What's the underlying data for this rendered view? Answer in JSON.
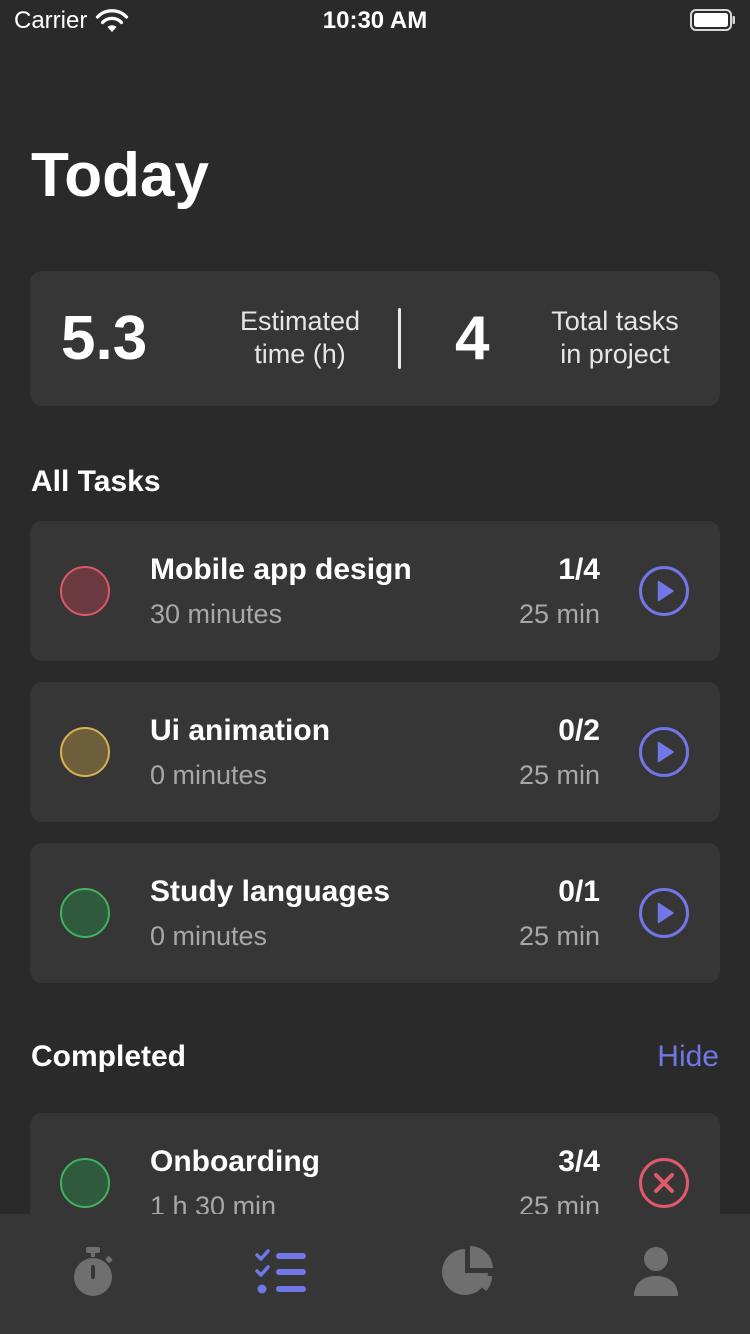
{
  "status_bar": {
    "carrier": "Carrier",
    "time": "10:30 AM",
    "wifi_icon": "wifi-icon",
    "battery_icon": "battery-icon"
  },
  "title": "Today",
  "stats": {
    "estimated_value": "5.3",
    "estimated_label_line1": "Estimated",
    "estimated_label_line2": "time (h)",
    "tasks_value": "4",
    "tasks_label_line1": "Total tasks",
    "tasks_label_line2": "in project"
  },
  "all_tasks": {
    "title": "All Tasks",
    "items": [
      {
        "name": "Mobile app design",
        "duration": "30 minutes",
        "progress": "1/4",
        "pomodoro": "25 min",
        "color": "#d85a69",
        "fill": "#6b3a40",
        "action_icon": "play-icon"
      },
      {
        "name": "Ui animation",
        "duration": "0 minutes",
        "progress": "0/2",
        "pomodoro": "25 min",
        "color": "#d9b152",
        "fill": "#6e5f3c",
        "action_icon": "play-icon"
      },
      {
        "name": "Study languages",
        "duration": "0 minutes",
        "progress": "0/1",
        "pomodoro": "25 min",
        "color": "#3fb35e",
        "fill": "#2f5a3d",
        "action_icon": "play-icon"
      }
    ]
  },
  "completed": {
    "title": "Completed",
    "hide_label": "Hide",
    "items": [
      {
        "name": "Onboarding",
        "duration": "1 h 30 min",
        "progress": "3/4",
        "pomodoro": "25 min",
        "color": "#3fb35e",
        "fill": "#2f5a3d",
        "action_icon": "close-circle-icon"
      }
    ]
  },
  "colors": {
    "background": "#2a2a2a",
    "card": "#363636",
    "accent": "#7177e6",
    "danger": "#e15a6c",
    "tab_inactive": "#6f6f6f"
  },
  "tab_bar": {
    "tabs": [
      {
        "icon": "stopwatch-icon",
        "active": false
      },
      {
        "icon": "task-list-icon",
        "active": true
      },
      {
        "icon": "pie-chart-icon",
        "active": false
      },
      {
        "icon": "profile-icon",
        "active": false
      }
    ]
  }
}
